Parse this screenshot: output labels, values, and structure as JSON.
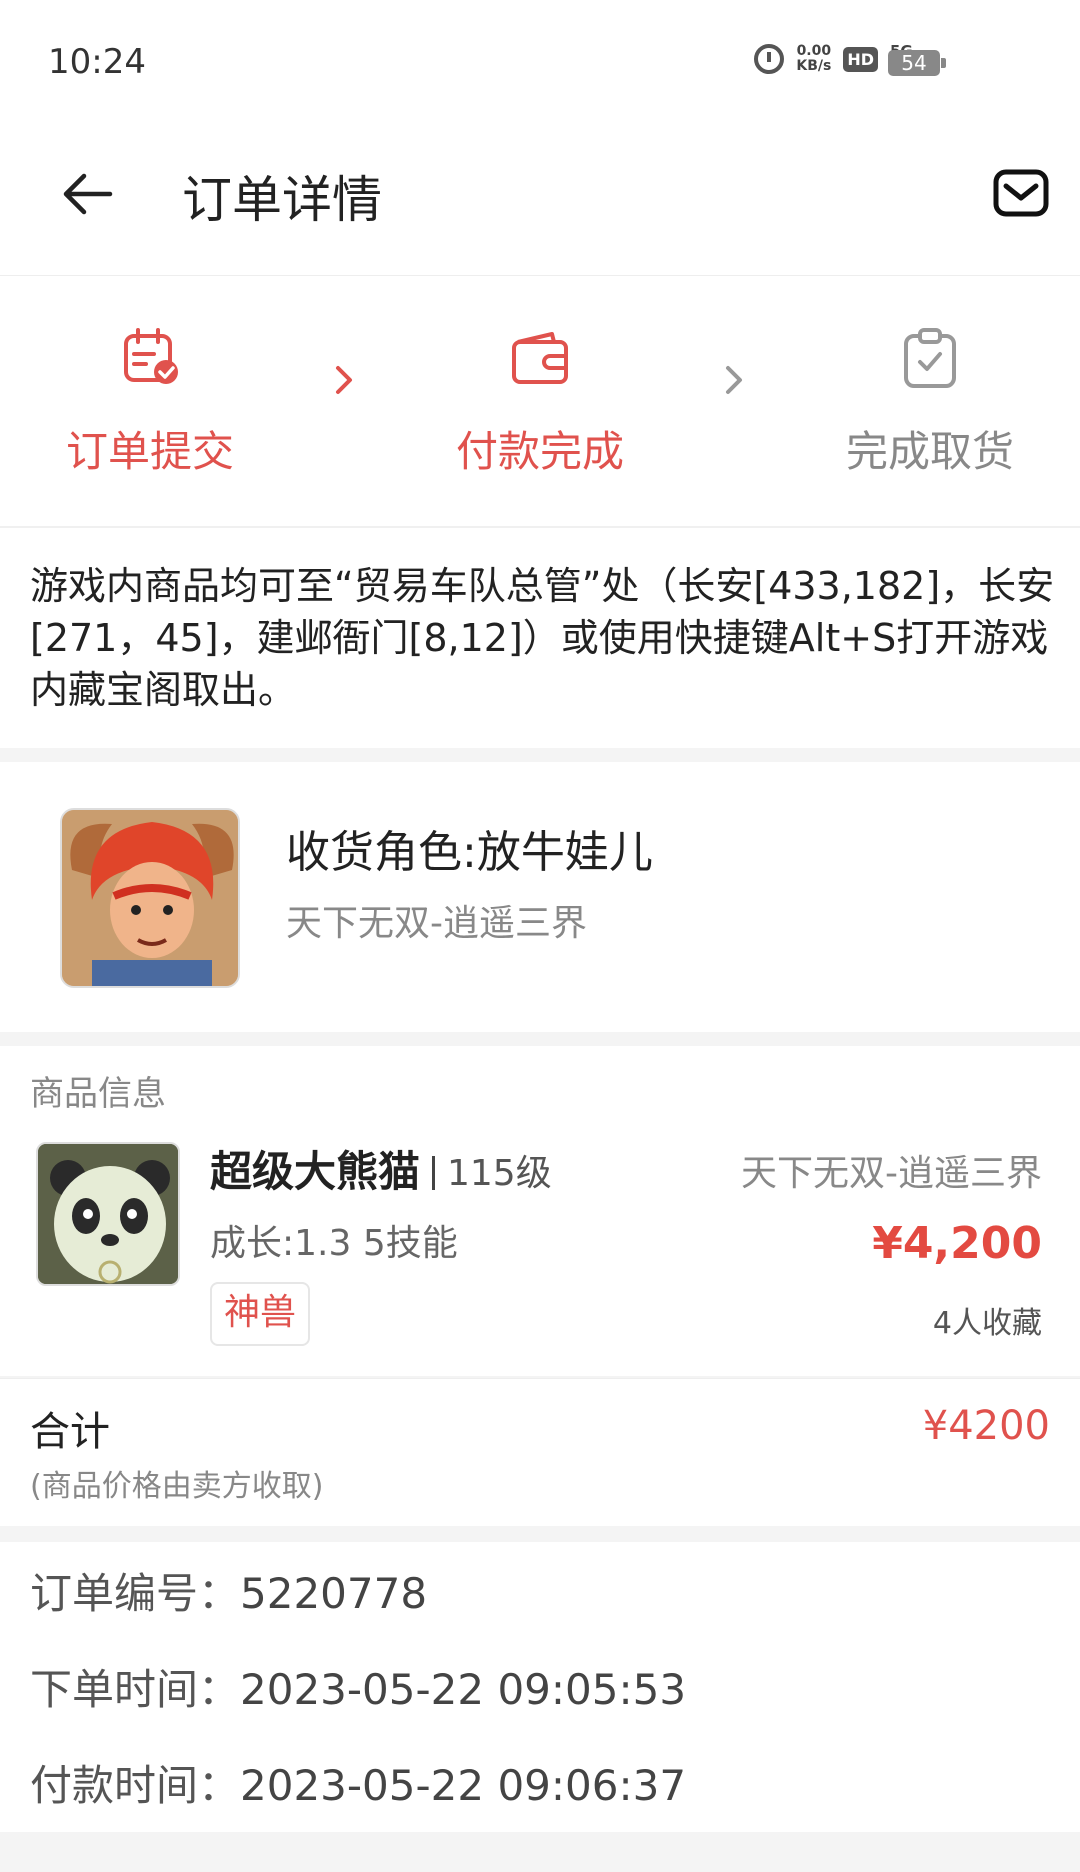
{
  "status_bar": {
    "time": "10:24",
    "net_speed_value": "0.00",
    "net_speed_unit": "KB/s",
    "hd_badge": "HD",
    "network": "5G",
    "battery": "54"
  },
  "header": {
    "title": "订单详情",
    "back_icon": "back-arrow-icon",
    "mail_icon": "mail-icon"
  },
  "steps": [
    {
      "label": "订单提交",
      "icon": "calendar-check-icon",
      "state": "done"
    },
    {
      "label": "付款完成",
      "icon": "wallet-icon",
      "state": "done"
    },
    {
      "label": "完成取货",
      "icon": "clipboard-check-icon",
      "state": "todo"
    }
  ],
  "notice": {
    "text": "游戏内商品均可至“贸易车队总管”处（长安[433,182]，长安[271，45]，建邺衙门[8,12]）或使用快捷键Alt+S打开游戏内藏宝阁取出。"
  },
  "receiver": {
    "role": "收货角色:放牛娃儿",
    "server": "天下无双-逍遥三界"
  },
  "product": {
    "section_title": "商品信息",
    "name": "超级大熊猫",
    "level": "115级",
    "stats": "成长:1.3 5技能",
    "tag": "神兽",
    "server": "天下无双-逍遥三界",
    "price": "¥4,200",
    "favorites": "4人收藏"
  },
  "total": {
    "label": "合计",
    "note": "(商品价格由卖方收取)",
    "value": "¥4200"
  },
  "order_info": {
    "order_no_label": "订单编号：",
    "order_no": "5220778",
    "order_time_label": "下单时间：",
    "order_time": "2023-05-22 09:05:53",
    "pay_time_label": "付款时间：",
    "pay_time": "2023-05-22 09:06:37"
  },
  "colors": {
    "accent": "#e0524d",
    "price": "#e34a41",
    "muted": "#888888"
  }
}
